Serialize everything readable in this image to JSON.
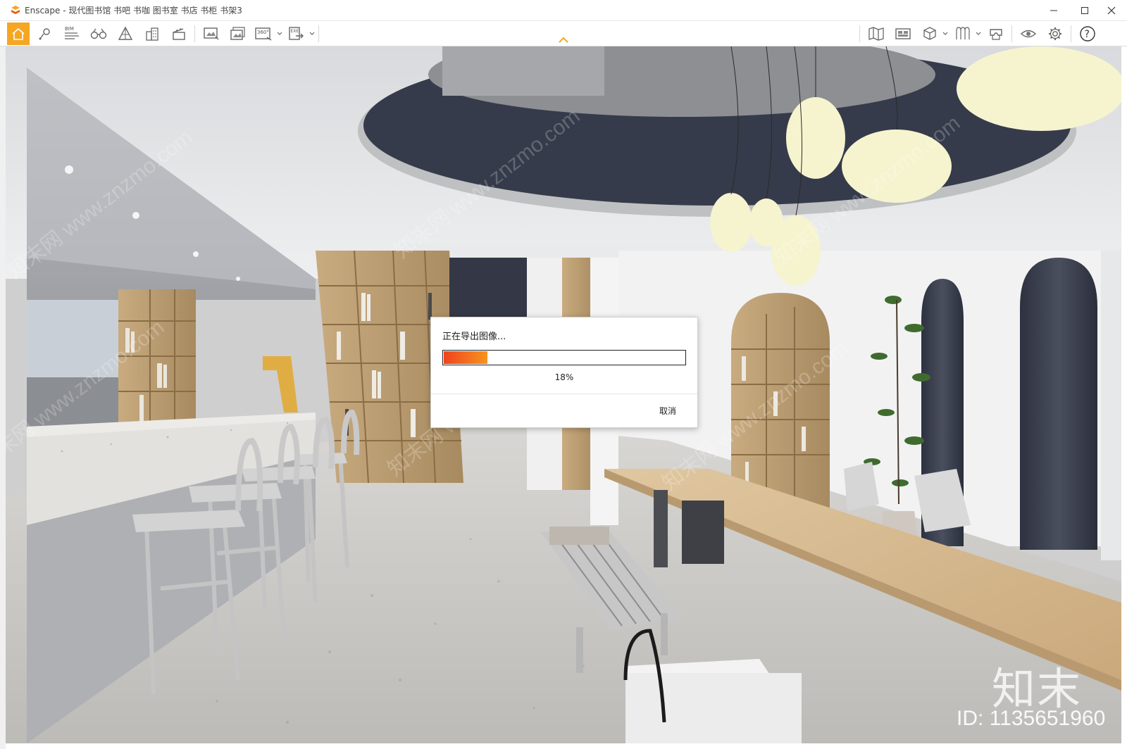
{
  "window": {
    "title": "Enscape - 现代图书馆 书吧 书咖 图书室 书店 书柜 书架3",
    "minimize_icon": "minimize-icon",
    "maximize_icon": "maximize-icon",
    "close_icon": "close-icon"
  },
  "toolbar": {
    "left_icons": [
      "home-icon",
      "location-icon",
      "bim-icon",
      "binoculars-icon",
      "perspective-icon",
      "buildings-icon",
      "clapper-icon",
      "screenshot-icon",
      "batch-render-icon",
      "panorama-360-icon",
      "export-exe-icon"
    ],
    "bim_label": "BIM",
    "panorama_label": "360°",
    "exe_label": "EXE",
    "right_icons": [
      "map-icon",
      "views-icon",
      "cube-icon",
      "materials-icon",
      "vr-headset-icon",
      "visibility-icon",
      "settings-icon",
      "help-icon"
    ],
    "help_label": "?"
  },
  "dialog": {
    "title": "正在导出图像...",
    "progress": 0.18,
    "progress_text": "18%",
    "cancel_label": "取消"
  },
  "watermark": {
    "logo_text": "知末",
    "id_text": "ID: 1135651960",
    "diagonal_text": "知末网 www.znzmo.com"
  },
  "colors": {
    "accent": "#f5a623",
    "progress_start": "#f1421e",
    "progress_end": "#f7941d"
  }
}
